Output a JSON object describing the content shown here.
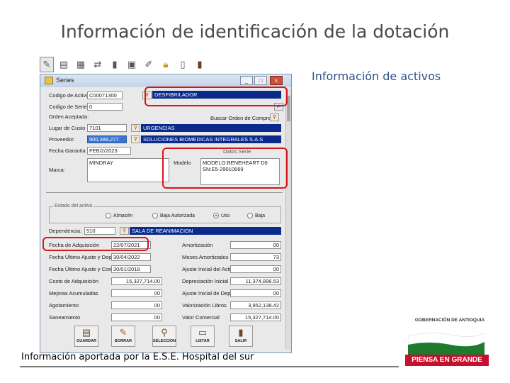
{
  "slide": {
    "title": "Información de identificación de la dotación",
    "side_label": "Información de activos",
    "caption": "Información aportada por la E.S.E. Hospital del sur"
  },
  "toolbar": {
    "icons": [
      "lamp-icon",
      "notes-icon",
      "calculator-icon",
      "chart-icon",
      "battery-icon",
      "report-icon",
      "pencil-icon",
      "lock-icon",
      "page-icon",
      "door-icon"
    ]
  },
  "window": {
    "title": "Series",
    "minimize": "_",
    "maximize": "□",
    "close": "x"
  },
  "form": {
    "codigo_activo": {
      "label": "Codigo de Activo",
      "value": "C00071300"
    },
    "descripcion": {
      "value": "DESFIBRILADOR"
    },
    "codigo_serie": {
      "label": "Codigo de Serie:",
      "value": "0"
    },
    "orden_aceptada": {
      "label": "Orden Aceptada:"
    },
    "buscar_orden": {
      "label": "Buscar Orden de Compra"
    },
    "lugar_de_custodia": {
      "label": "Lugar de Custo",
      "code": "7101",
      "value": "URGENCIAS"
    },
    "proveedor": {
      "label": "Proveedor:",
      "code": "900,388,277",
      "value": "SOLUCIONES BIOMEDICAS INTEGRALES S.A.S"
    },
    "fecha_garantia": {
      "label": "Fecha Garantia",
      "value": "FEB/2/2023"
    },
    "datos_serie_label": "Datos Serie",
    "marca": {
      "label": "Marca:",
      "value": "MINDRAY"
    },
    "modelo": {
      "label": "Modelo",
      "value": "MODELO:BENEHEART D6 SN:E5-29010669"
    },
    "estado": {
      "group_label": "Estado del activo",
      "options": [
        "Almacén",
        "Baja Autorizada",
        "Uso",
        "Baja"
      ],
      "selected": "Uso"
    },
    "dependencia": {
      "label": "Dependencia:",
      "code": "510",
      "value": "SALA DE REANIMACION"
    },
    "left_fields": [
      {
        "label": "Fecha de Adquisición",
        "value": "22/07/2021"
      },
      {
        "label": "Fecha Último Ajuste y Dep.",
        "value": "30/04/2022"
      },
      {
        "label": "Fecha Último Ajuste y Cont.",
        "value": "30/01/2018"
      },
      {
        "label": "Costo de Adquisición",
        "value": "15,327,714.00"
      },
      {
        "label": "Mejoras Acumuladas",
        "value": "00"
      },
      {
        "label": "Agotamiento",
        "value": "00"
      },
      {
        "label": "Saneamiento",
        "value": "00"
      }
    ],
    "right_fields": [
      {
        "label": "Amortización",
        "value": "00"
      },
      {
        "label": "Meses Amortizados",
        "value": "73"
      },
      {
        "label": "Ajuste Inicial del Acti",
        "value": "00"
      },
      {
        "label": "Depreciación Inicial",
        "value": "11,374,896.53"
      },
      {
        "label": "Ajuste Inicial de Deprec",
        "value": "00"
      },
      {
        "label": "Valorización Libros",
        "value": "3,952,138.42"
      },
      {
        "label": "Valor Comercial",
        "value": "15,327,714.00"
      }
    ],
    "buttons": [
      {
        "label": "GUARDAR",
        "icon": "save-icon"
      },
      {
        "label": "BORRAR",
        "icon": "eraser-icon"
      },
      {
        "label": "SELECCION",
        "icon": "selection-icon"
      },
      {
        "label": "LISTAR",
        "icon": "printer-icon"
      },
      {
        "label": "SALIR",
        "icon": "exit-door-icon"
      }
    ]
  },
  "logo": {
    "top_text": "GOBERNACIÓN DE ANTIOQUIA",
    "band_text": "PIENSA EN GRANDE",
    "colors": {
      "green": "#1f7a2e",
      "white": "#ffffff",
      "red": "#c8102e"
    }
  },
  "highlight_color": "#d8141c"
}
